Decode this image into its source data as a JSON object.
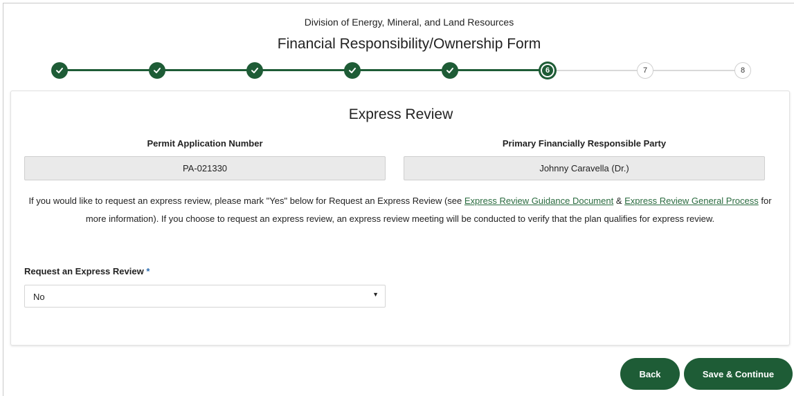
{
  "header": {
    "division": "Division of Energy, Mineral, and Land Resources",
    "form_title": "Financial Responsibility/Ownership Form"
  },
  "stepper": {
    "current_step": 6,
    "steps": [
      "1",
      "2",
      "3",
      "4",
      "5",
      "6",
      "7",
      "8"
    ],
    "completed_icon": "check-icon",
    "accent_color": "#1e5c36"
  },
  "card": {
    "title": "Express Review",
    "permit_label": "Permit Application Number",
    "permit_value": "PA-021330",
    "party_label": "Primary Financially Responsible Party",
    "party_value": "Johnny Caravella (Dr.)",
    "info": {
      "text1": "If you would like to request an express review, please mark \"Yes\" below for Request an Express Review (see ",
      "link1": "Express Review Guidance Document",
      "text2": " & ",
      "link2": "Express Review General Process",
      "text3": " for more information). If you choose to request an express review, an express review meeting will be conducted to verify that the plan qualifies for express review."
    },
    "request_label": "Request an Express Review",
    "request_required": "*",
    "request_value": "No"
  },
  "actions": {
    "back": "Back",
    "save_continue": "Save & Continue"
  }
}
